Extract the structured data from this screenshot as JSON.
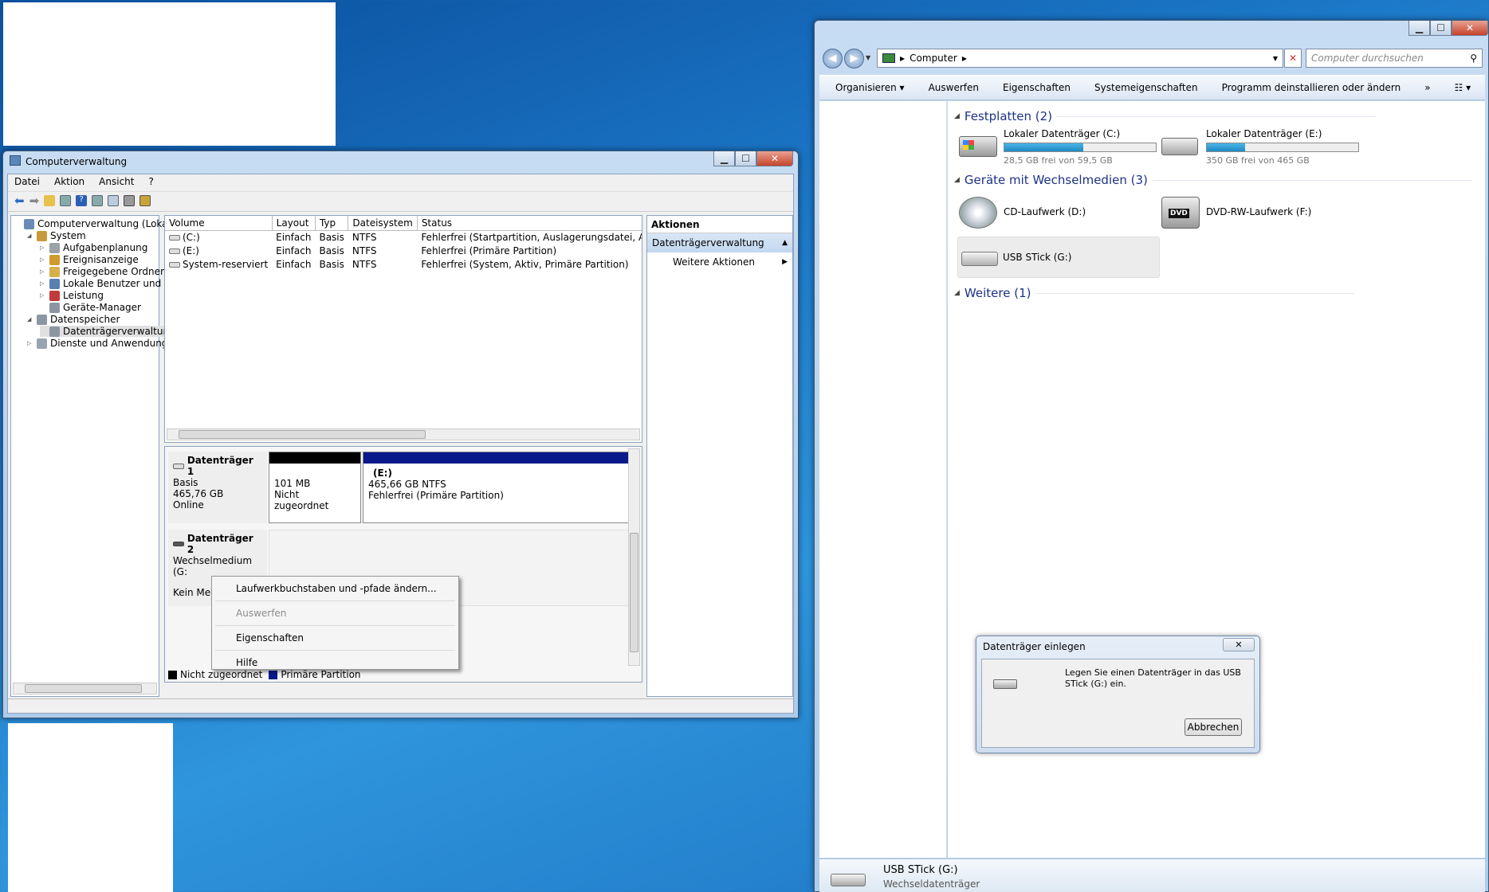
{
  "compmgmt": {
    "title": "Computerverwaltung",
    "menu": [
      "Datei",
      "Aktion",
      "Ansicht",
      "?"
    ],
    "tree": [
      {
        "label": "Computerverwaltung (Lokal)",
        "level": 0,
        "icon": "computer-icon"
      },
      {
        "label": "System",
        "level": 1,
        "icon": "tools-icon"
      },
      {
        "label": "Aufgabenplanung",
        "level": 2,
        "icon": "clock-icon"
      },
      {
        "label": "Ereignisanzeige",
        "level": 2,
        "icon": "event-viewer-icon"
      },
      {
        "label": "Freigegebene Ordner",
        "level": 2,
        "icon": "shared-folder-icon"
      },
      {
        "label": "Lokale Benutzer und Gr",
        "level": 2,
        "icon": "users-icon"
      },
      {
        "label": "Leistung",
        "level": 2,
        "icon": "performance-icon"
      },
      {
        "label": "Geräte-Manager",
        "level": 2,
        "icon": "device-manager-icon"
      },
      {
        "label": "Datenspeicher",
        "level": 1,
        "icon": "storage-icon"
      },
      {
        "label": "Datenträgerverwaltung",
        "level": 2,
        "icon": "disk-management-icon"
      },
      {
        "label": "Dienste und Anwendungen",
        "level": 1,
        "icon": "services-icon"
      }
    ],
    "columns": [
      "Volume",
      "Layout",
      "Typ",
      "Dateisystem",
      "Status"
    ],
    "volumes": [
      [
        "(C:)",
        "Einfach",
        "Basis",
        "NTFS",
        "Fehlerfrei (Startpartition, Auslagerungsdatei, Absturzabbild"
      ],
      [
        "(E:)",
        "Einfach",
        "Basis",
        "NTFS",
        "Fehlerfrei (Primäre Partition)"
      ],
      [
        "System-reserviert",
        "Einfach",
        "Basis",
        "NTFS",
        "Fehlerfrei (System, Aktiv, Primäre Partition)"
      ]
    ],
    "disk1": {
      "name": "Datenträger 1",
      "type": "Basis",
      "size": "465,76 GB",
      "state": "Online",
      "part1_size": "101 MB",
      "part1_state": "Nicht zugeordnet",
      "part2_name": "(E:)",
      "part2_size": "465,66 GB NTFS",
      "part2_state": "Fehlerfrei (Primäre Partition)"
    },
    "disk2": {
      "name": "Datenträger 2",
      "type": "Wechselmedium (G:",
      "state": "Kein Med"
    },
    "legend": [
      "Nicht zugeordnet",
      "Primäre Partition"
    ],
    "actions": {
      "header": "Aktionen",
      "section": "Datenträgerverwaltung",
      "more": "Weitere Aktionen"
    },
    "context_menu": [
      "Laufwerkbuchstaben und -pfade ändern...",
      "Auswerfen",
      "Eigenschaften",
      "Hilfe"
    ],
    "colors": {
      "unallocated": "#000000",
      "primary": "#0a1a8a"
    }
  },
  "explorer": {
    "address": "Computer",
    "search_placeholder": "Computer durchsuchen",
    "toolbar": [
      "Organisieren",
      "Auswerfen",
      "Eigenschaften",
      "Systemeigenschaften",
      "Programm deinstallieren oder ändern",
      "»"
    ],
    "groups": {
      "hdd": "Festplatten (2)",
      "removable": "Geräte mit Wechselmedien (3)",
      "other": "Weitere (1)"
    },
    "drives": {
      "c": {
        "name": "Lokaler Datenträger (C:)",
        "free": "28,5 GB frei von 59,5 GB",
        "used_fraction": 0.52
      },
      "e": {
        "name": "Lokaler Datenträger (E:)",
        "free": "350 GB frei von 465 GB",
        "used_fraction": 0.25
      },
      "d": {
        "name": "CD-Laufwerk (D:)"
      },
      "f": {
        "name": "DVD-RW-Laufwerk (F:)",
        "badge": "DVD"
      },
      "g": {
        "name": "USB STick (G:)"
      }
    },
    "details": {
      "name": "USB STick (G:)",
      "type": "Wechseldatenträger"
    }
  },
  "dialog": {
    "title": "Datenträger einlegen",
    "message": "Legen Sie einen Datenträger in das USB STick (G:) ein.",
    "cancel": "Abbrechen"
  }
}
